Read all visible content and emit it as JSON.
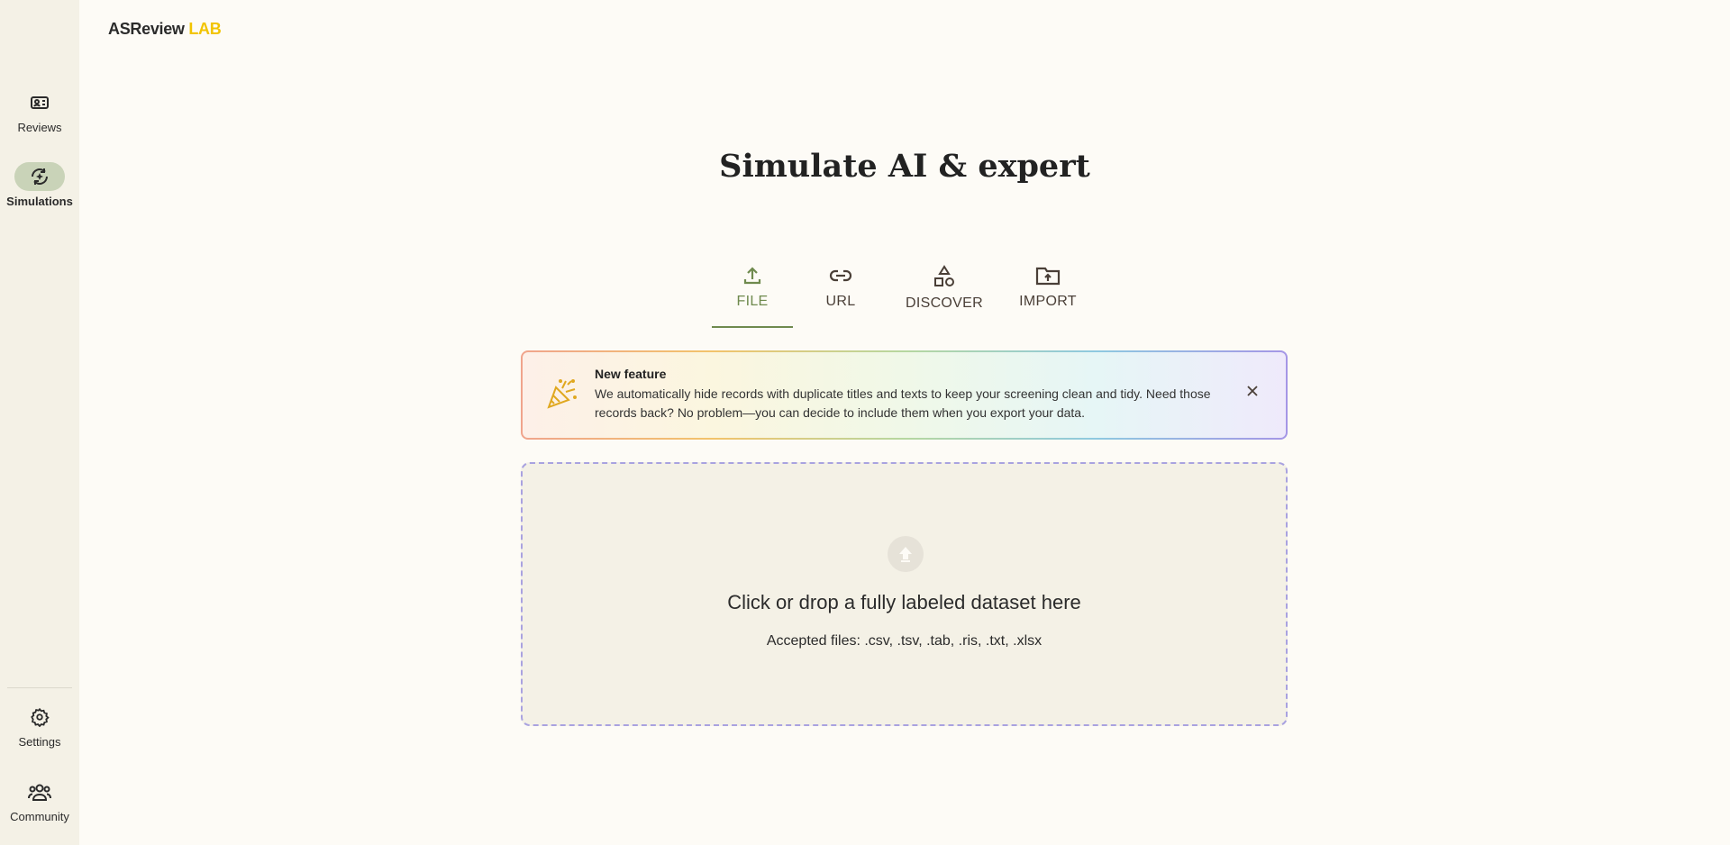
{
  "app": {
    "logo_main": "ASReview",
    "logo_accent": "LAB"
  },
  "sidebar": {
    "items": [
      {
        "label": "Reviews",
        "icon": "reviews-icon",
        "active": false
      },
      {
        "label": "Simulations",
        "icon": "simulations-icon",
        "active": true
      },
      {
        "label": "Settings",
        "icon": "gear-icon",
        "active": false
      },
      {
        "label": "Community",
        "icon": "community-icon",
        "active": false
      }
    ]
  },
  "main": {
    "title": "Simulate AI & expert",
    "tabs": [
      {
        "label": "FILE",
        "icon": "upload-icon",
        "active": true
      },
      {
        "label": "URL",
        "icon": "link-icon",
        "active": false
      },
      {
        "label": "DISCOVER",
        "icon": "shapes-icon",
        "active": false
      },
      {
        "label": "IMPORT",
        "icon": "folder-upload-icon",
        "active": false
      }
    ],
    "banner": {
      "title": "New feature",
      "body": "We automatically hide records with duplicate titles and texts to keep your screening clean and tidy. Need those records back? No problem—you can decide to include them when you export your data.",
      "icon": "party-popper-icon"
    },
    "dropzone": {
      "main_text": "Click or drop a fully labeled dataset here",
      "accepted_text": "Accepted files: .csv, .tsv, .tab, .ris, .txt, .xlsx",
      "icon": "upload-circle-icon"
    }
  },
  "colors": {
    "accent": "#6f8a4e",
    "logo_accent": "#f2c400",
    "sidebar_bg": "#f4f1e6",
    "page_bg": "#fdfbf6",
    "active_pill": "#c9d3b8",
    "dropzone_border": "#a9a2e0"
  }
}
